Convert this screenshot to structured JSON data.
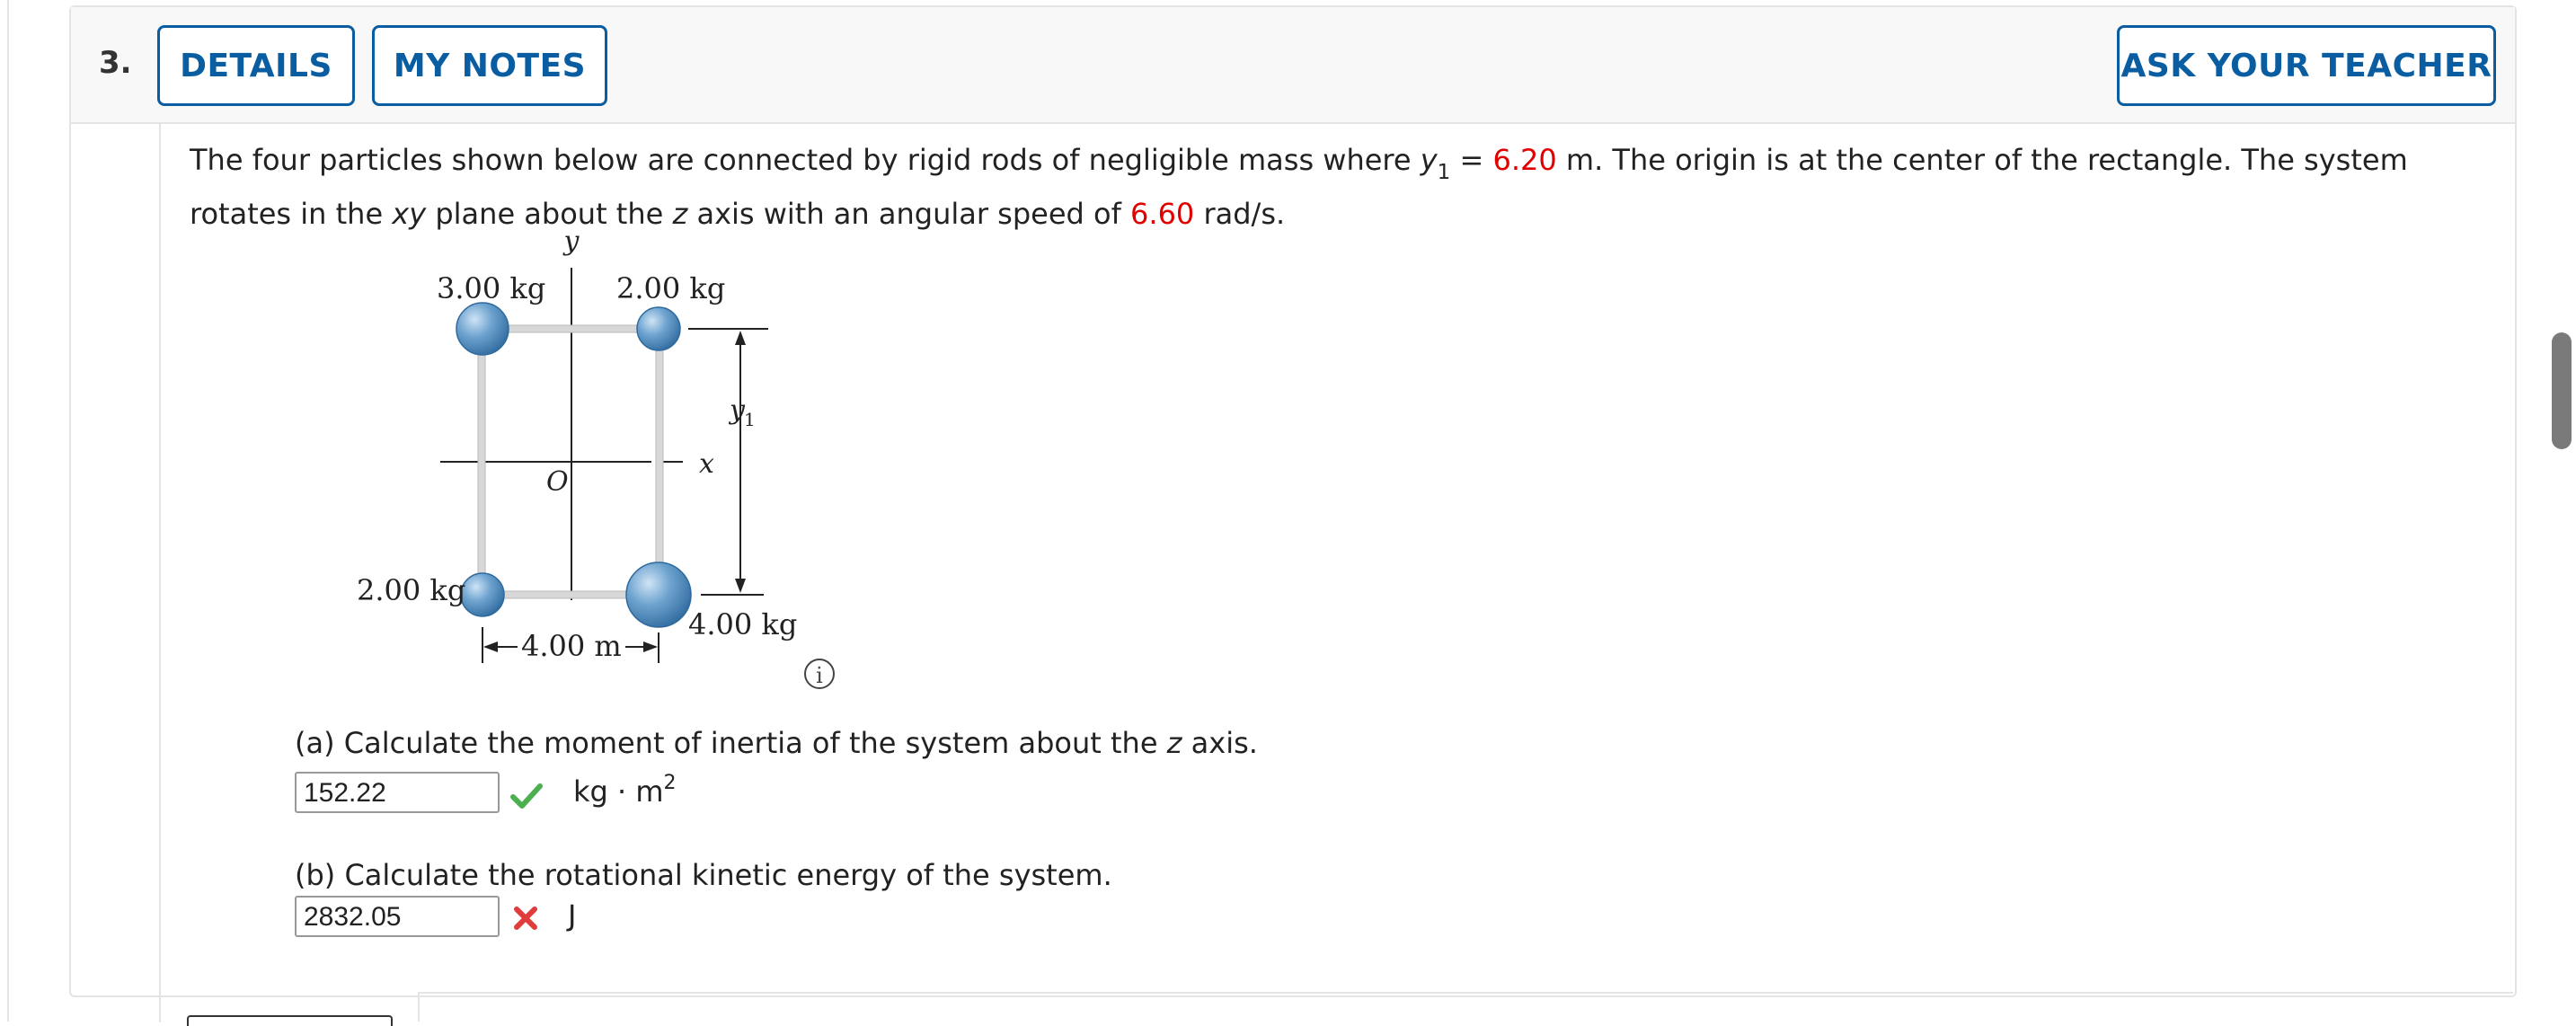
{
  "question": {
    "number": "3.",
    "buttons": {
      "details": "DETAILS",
      "my_notes": "MY NOTES",
      "ask_teacher": "ASK YOUR TEACHER"
    },
    "prompt": {
      "p1": "The four particles shown below are connected by rigid rods of negligible mass where ",
      "var_y": "y",
      "var_y_sub": "1",
      "eq": " = ",
      "y1_value": "6.20",
      "p2": " m. The origin is at the center of the rectangle. The system rotates in the ",
      "plane": "xy",
      "p3": " plane about the ",
      "axis": "z",
      "p4": " axis with an angular speed of ",
      "omega_value": "6.60",
      "p5": " rad/s."
    },
    "figure": {
      "mass_top_left": "3.00 kg",
      "mass_top_right": "2.00 kg",
      "mass_bottom_left": "2.00 kg",
      "mass_bottom_right": "4.00 kg",
      "width_label": "4.00 m",
      "axis_y": "y",
      "axis_x": "x",
      "origin": "O",
      "dim_label": "y",
      "dim_label_sub": "1",
      "info": "i"
    },
    "part_a": {
      "p1": "(a) Calculate the moment of inertia of the system about the ",
      "axis": "z",
      "p2": " axis.",
      "answer": "152.22",
      "unit": "kg · m",
      "unit_sup": "2",
      "status": "correct",
      "status_color": "#4caf50"
    },
    "part_b": {
      "label": "(b) Calculate the rotational kinetic energy of the system.",
      "answer": "2832.05",
      "unit": "J",
      "status": "incorrect",
      "status_color": "#e03c3c"
    }
  },
  "colors": {
    "accent": "#0a5da0",
    "highlight": "#e00000"
  }
}
